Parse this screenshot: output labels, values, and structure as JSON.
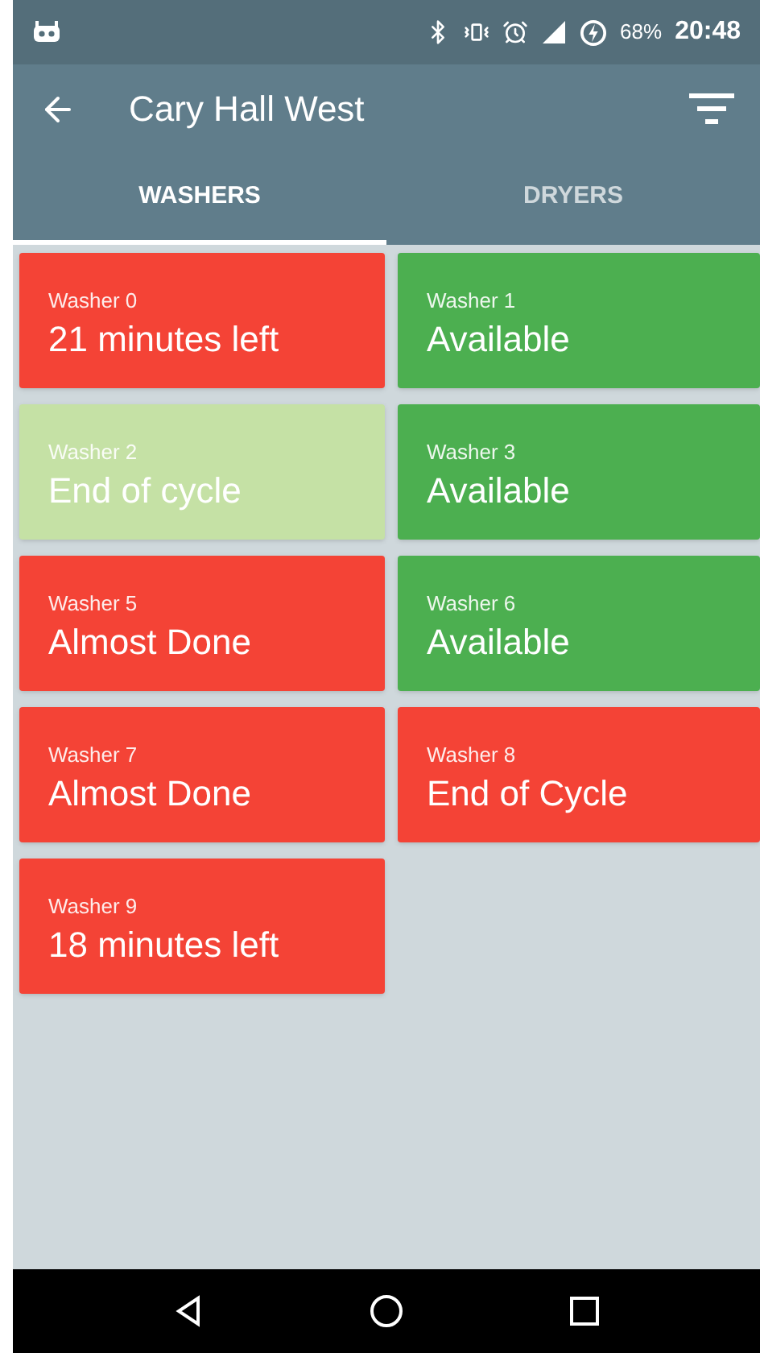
{
  "status_bar": {
    "battery": "68%",
    "time": "20:48"
  },
  "app_bar": {
    "title": "Cary Hall West"
  },
  "tabs": [
    {
      "label": "WASHERS",
      "selected": true
    },
    {
      "label": "DRYERS",
      "selected": false
    }
  ],
  "machines": [
    {
      "name": "Washer 0",
      "status": "21 minutes left",
      "color": "#f44336"
    },
    {
      "name": "Washer 1",
      "status": "Available",
      "color": "#4caf50"
    },
    {
      "name": "Washer 2",
      "status": "End of cycle",
      "color": "#c5e1a5"
    },
    {
      "name": "Washer 3",
      "status": "Available",
      "color": "#4caf50"
    },
    {
      "name": "Washer 5",
      "status": "Almost Done",
      "color": "#f44336"
    },
    {
      "name": "Washer 6",
      "status": "Available",
      "color": "#4caf50"
    },
    {
      "name": "Washer 7",
      "status": "Almost Done",
      "color": "#f44336"
    },
    {
      "name": "Washer 8",
      "status": "End of Cycle",
      "color": "#f44336"
    },
    {
      "name": "Washer 9",
      "status": "18 minutes left",
      "color": "#f44336"
    }
  ]
}
